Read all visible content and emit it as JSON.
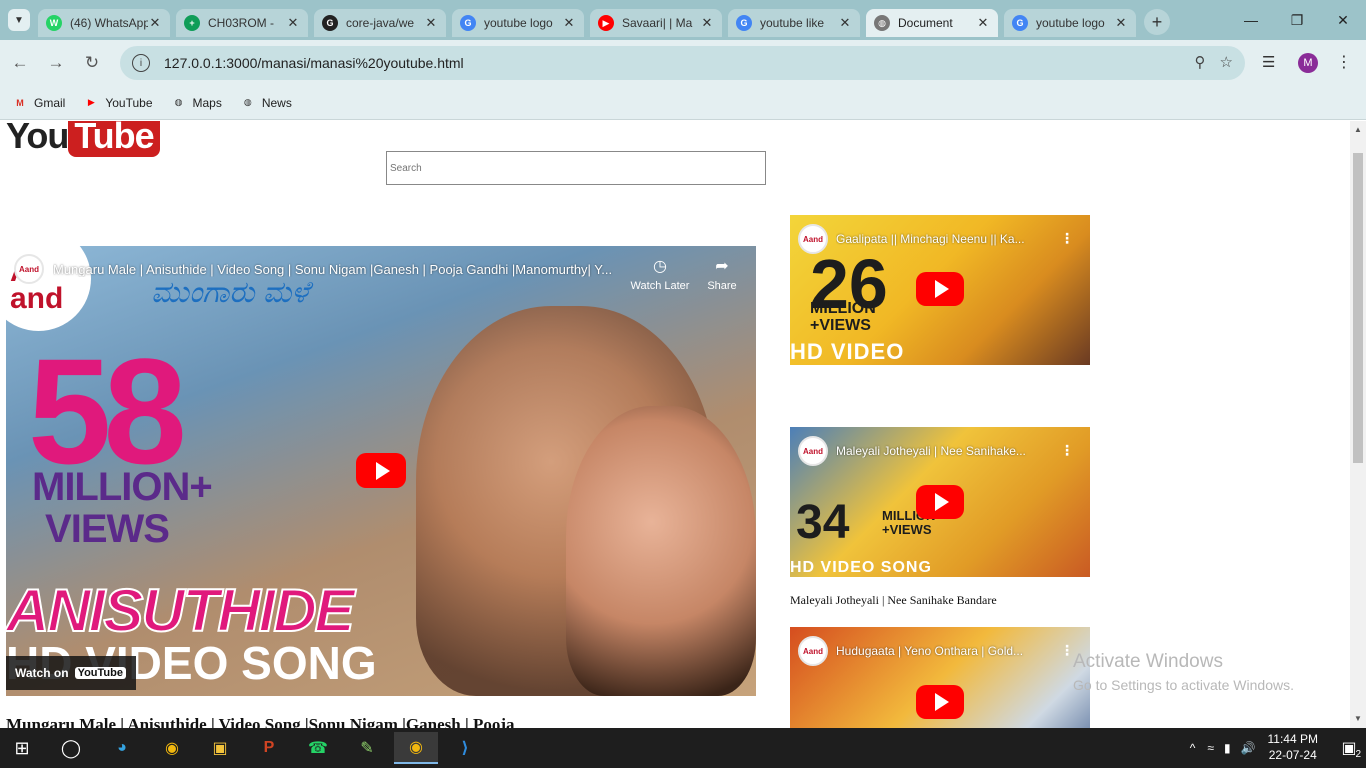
{
  "browser": {
    "tabs": [
      {
        "title": "(46) WhatsApp",
        "icon": "whatsapp-icon",
        "color": "#25d366",
        "glyph": "W"
      },
      {
        "title": "CH03ROM - ",
        "icon": "sheets-icon",
        "color": "#0f9d58",
        "glyph": "+"
      },
      {
        "title": "core-java/we",
        "icon": "github-icon",
        "color": "#222222",
        "glyph": "G"
      },
      {
        "title": "youtube logo",
        "icon": "google-icon",
        "color": "#4285f4",
        "glyph": "G"
      },
      {
        "title": "Savaari| | Ma",
        "icon": "youtube-icon",
        "color": "#ff0000",
        "glyph": "▶"
      },
      {
        "title": "youtube like",
        "icon": "google-icon",
        "color": "#4285f4",
        "glyph": "G"
      },
      {
        "title": "Document",
        "icon": "globe-icon",
        "color": "#777777",
        "glyph": "◍",
        "active": true
      },
      {
        "title": "youtube logo",
        "icon": "google-icon",
        "color": "#4285f4",
        "glyph": "G"
      }
    ],
    "url": "127.0.0.1:3000/manasi/manasi%20youtube.html",
    "avatar_letter": "M",
    "bookmarks": [
      {
        "label": "Gmail",
        "icon": "gmail-icon",
        "glyph": "M",
        "color": "#d93025"
      },
      {
        "label": "YouTube",
        "icon": "youtube-icon",
        "glyph": "▶",
        "color": "#ff0000"
      },
      {
        "label": "Maps",
        "icon": "globe-icon",
        "glyph": "◍",
        "color": "#333333"
      },
      {
        "label": "News",
        "icon": "globe-icon",
        "glyph": "◍",
        "color": "#333333"
      }
    ]
  },
  "page": {
    "logo": {
      "you": "You",
      "tube": "Tube"
    },
    "search_placeholder": "Search",
    "main_video": {
      "title": "Mungaru Male | Anisuthide | Video Song | Sonu Nigam |Ganesh | Pooja Gandhi |Manomurthy| Y...",
      "thumb_big": "58",
      "thumb_million": "MILLION+ VIEWS",
      "thumb_song": "ANISUTHIDE",
      "thumb_hd": "HD VIDEO SONG",
      "channel": "Anand Audio",
      "watch_later": "Watch Later",
      "share": "Share",
      "watch_on": "Watch on",
      "watch_on_brand": "YouTube"
    },
    "main_caption": "Mungaru Male | Anisuthide | Video Song |Sonu Nigam |Ganesh | Pooja",
    "side_videos": [
      {
        "title": "Gaalipata || Minchagi Neenu || Ka...",
        "thumb_big": "26",
        "thumb_sub": "MILLION +VIEWS",
        "thumb_hd": "HD VIDEO",
        "caption": ""
      },
      {
        "title": "Maleyali Jotheyali | Nee Sanihake...",
        "thumb_big": "34",
        "thumb_sub": "MILLION +VIEWS",
        "thumb_hd": "HD VIDEO SONG",
        "caption": "Maleyali Jotheyali | Nee Sanihake Bandare"
      },
      {
        "title": "Hudugaata | Yeno Onthara | Gold...",
        "thumb_big": "",
        "thumb_sub": "",
        "thumb_hd": "",
        "caption": ""
      }
    ],
    "watermark": {
      "line1": "Activate Windows",
      "line2": "Go to Settings to activate Windows."
    }
  },
  "taskbar": {
    "time": "11:44 PM",
    "date": "22-07-24",
    "notification_count": "2"
  }
}
